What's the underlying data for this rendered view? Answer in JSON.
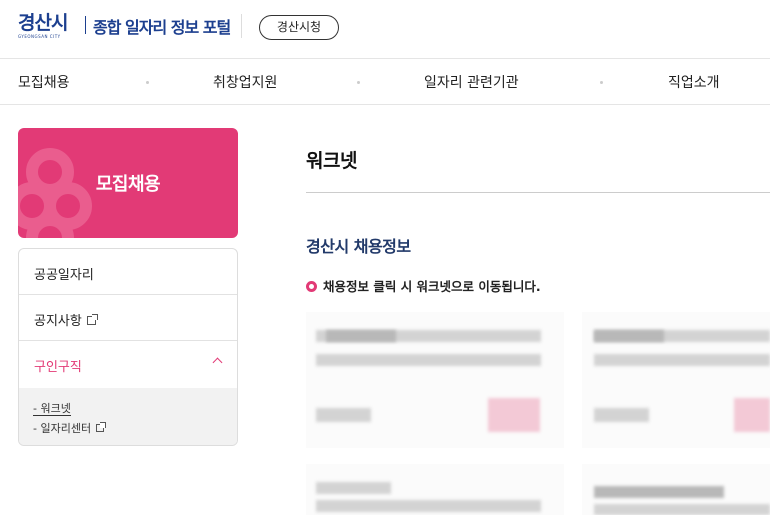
{
  "header": {
    "logo_main": "경산시",
    "logo_sub": "GYEONGSAN CITY",
    "portal_title": "종합 일자리 정보 포털",
    "city_button": "경산시청"
  },
  "gnb": {
    "items": [
      "모집채용",
      "취창업지원",
      "일자리 관련기관",
      "직업소개"
    ]
  },
  "sidebar": {
    "heading": "모집채용",
    "items": [
      {
        "label": "공공일자리"
      },
      {
        "label": "공지사항"
      },
      {
        "label": "구인구직"
      }
    ],
    "subitems": [
      {
        "label": "- 워크넷"
      },
      {
        "label": "- 일자리센터"
      }
    ]
  },
  "main": {
    "page_title": "워크넷",
    "section_title": "경산시 채용정보",
    "notice": "채용정보 클릭 시 워크넷으로 이동됩니다."
  },
  "colors": {
    "brand_pink": "#e23a76",
    "brand_navy": "#1c3f8f"
  },
  "icons": [
    "external-link-icon",
    "chevron-up-icon",
    "bullet-circle-icon",
    "flower-emblem-icon"
  ]
}
